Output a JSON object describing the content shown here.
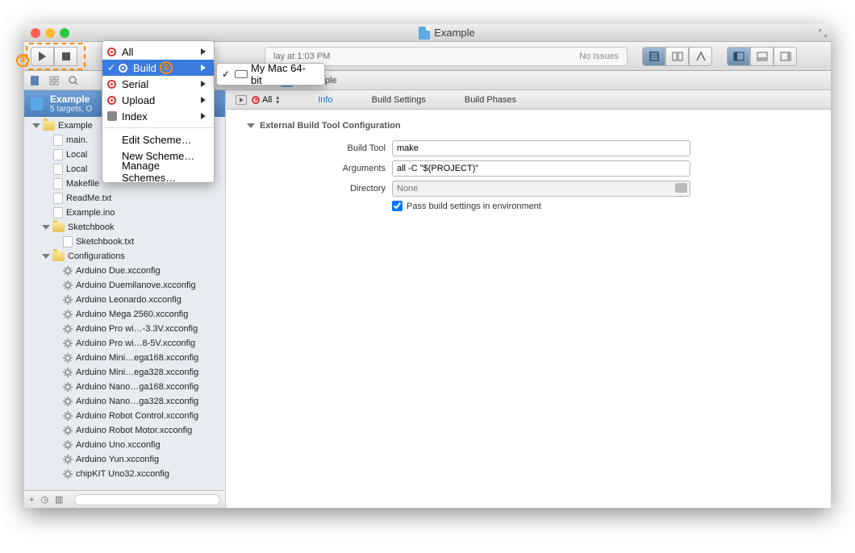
{
  "window": {
    "title": "Example"
  },
  "status": {
    "text": "lay at 1:03 PM",
    "right": "No Issues"
  },
  "sidebar": {
    "project": {
      "name": "Example",
      "sub": "5 targets, O"
    },
    "tree": {
      "root": "Example",
      "files": [
        "main.",
        "Local",
        "Local",
        "Makefile",
        "ReadMe.txt",
        "Example.ino"
      ],
      "sketchbook": {
        "label": "Sketchbook",
        "items": [
          "Sketchbook.txt"
        ]
      },
      "configurations": {
        "label": "Configurations",
        "items": [
          "Arduino Due.xcconfig",
          "Arduino Duemilanove.xcconfig",
          "Arduino Leonardo.xcconfig",
          "Arduino Mega 2560.xcconfig",
          "Arduino Pro wi…-3.3V.xcconfig",
          "Arduino Pro wi…8-5V.xcconfig",
          "Arduino Mini…ega168.xcconfig",
          "Arduino Mini…ega328.xcconfig",
          "Arduino Nano…ga168.xcconfig",
          "Arduino Nano…ga328.xcconfig",
          "Arduino Robot Control.xcconfig",
          "Arduino Robot Motor.xcconfig",
          "Arduino Uno.xcconfig",
          "Arduino Yun.xcconfig",
          "chipKIT Uno32.xcconfig"
        ]
      }
    }
  },
  "breadcrumb": {
    "item": "Example"
  },
  "tabs": {
    "target": "All",
    "info": "Info",
    "buildSettings": "Build Settings",
    "buildPhases": "Build Phases"
  },
  "section": {
    "header": "External Build Tool Configuration",
    "buildTool": {
      "label": "Build Tool",
      "value": "make"
    },
    "arguments": {
      "label": "Arguments",
      "value": "all -C \"$(PROJECT)\""
    },
    "directory": {
      "label": "Directory",
      "placeholder": "None"
    },
    "checkbox": "Pass build settings in environment"
  },
  "menu": {
    "items": [
      "All",
      "Build",
      "Serial",
      "Upload",
      "Index"
    ],
    "selected": "Build",
    "editScheme": "Edit Scheme…",
    "newScheme": "New Scheme…",
    "manageSchemes": "Manage Schemes…"
  },
  "submenu": {
    "destination": "My Mac 64-bit"
  },
  "annotations": {
    "a1": "①",
    "a2": "②"
  }
}
